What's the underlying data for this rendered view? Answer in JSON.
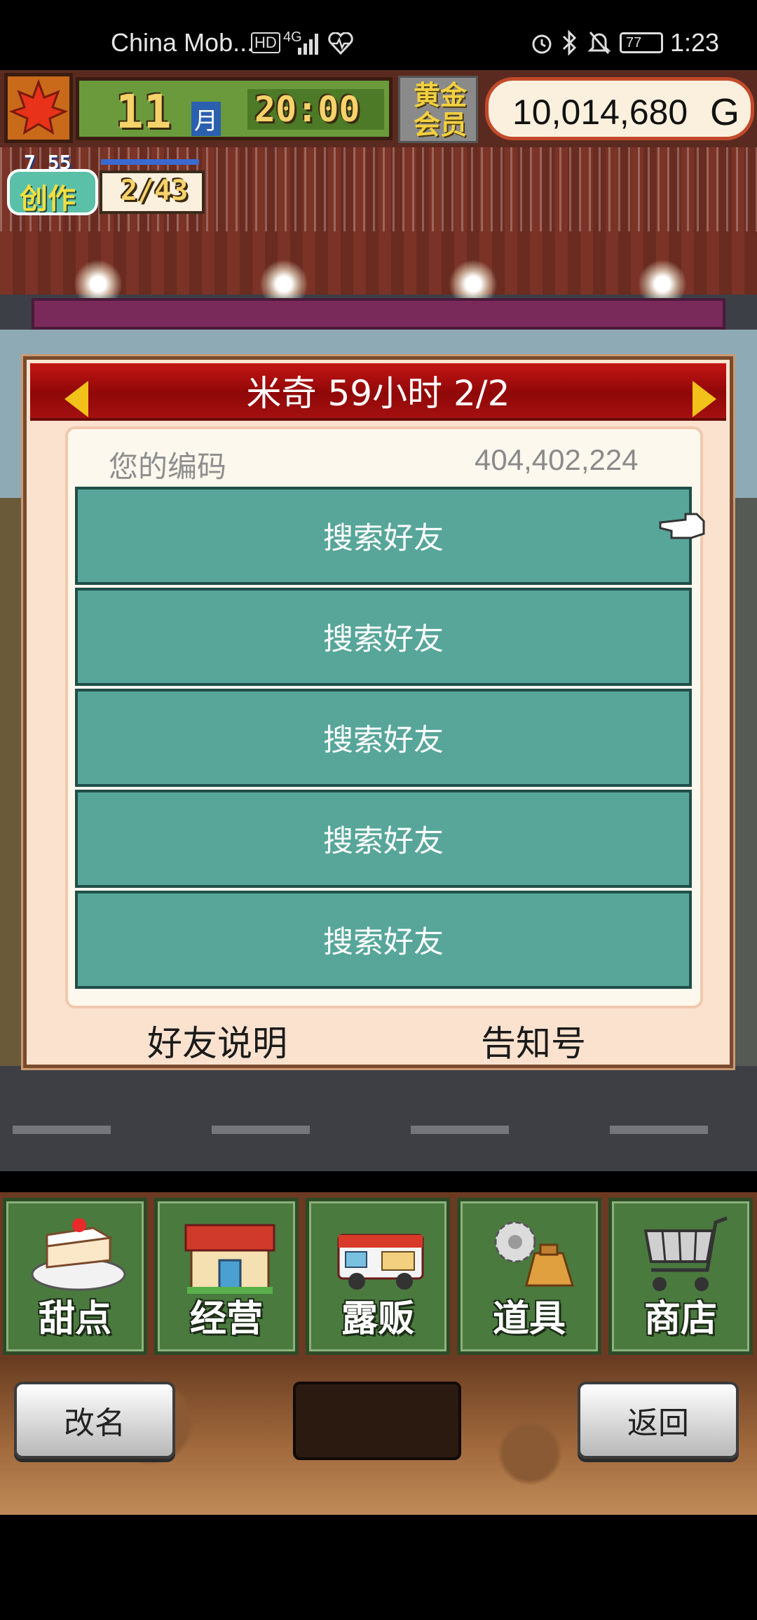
{
  "status_bar": {
    "carrier": "China Mob...",
    "hd_badge": "HD",
    "network": "4G",
    "battery": "77",
    "time": "1:23"
  },
  "hud": {
    "month_number": "11",
    "month_unit": "月",
    "clock": "20:00",
    "membership": "黄金会员",
    "gold": "10,014,680",
    "gold_unit": "G",
    "creation_label": "创作",
    "creation_level": "7 55",
    "creation_progress": "2/43"
  },
  "dialog": {
    "title": "米奇  59小时 2/2",
    "code_label": "您的编码",
    "code_value": "404,402,224",
    "friend_slots": [
      "搜索好友",
      "搜索好友",
      "搜索好友",
      "搜索好友",
      "搜索好友"
    ],
    "footer_left": "好友说明",
    "footer_right": "告知号"
  },
  "menu": [
    {
      "label": "甜点",
      "icon": "cake-icon"
    },
    {
      "label": "经营",
      "icon": "shop-icon"
    },
    {
      "label": "露贩",
      "icon": "food-truck-icon"
    },
    {
      "label": "道具",
      "icon": "items-bag-icon"
    },
    {
      "label": "商店",
      "icon": "shopping-cart-icon"
    }
  ],
  "bottom_bar": {
    "rename_label": "改名",
    "back_label": "返回"
  },
  "colors": {
    "dialog_header": "#b01010",
    "friend_slot": "#57a699",
    "menu_tile": "#4a7a3e"
  }
}
